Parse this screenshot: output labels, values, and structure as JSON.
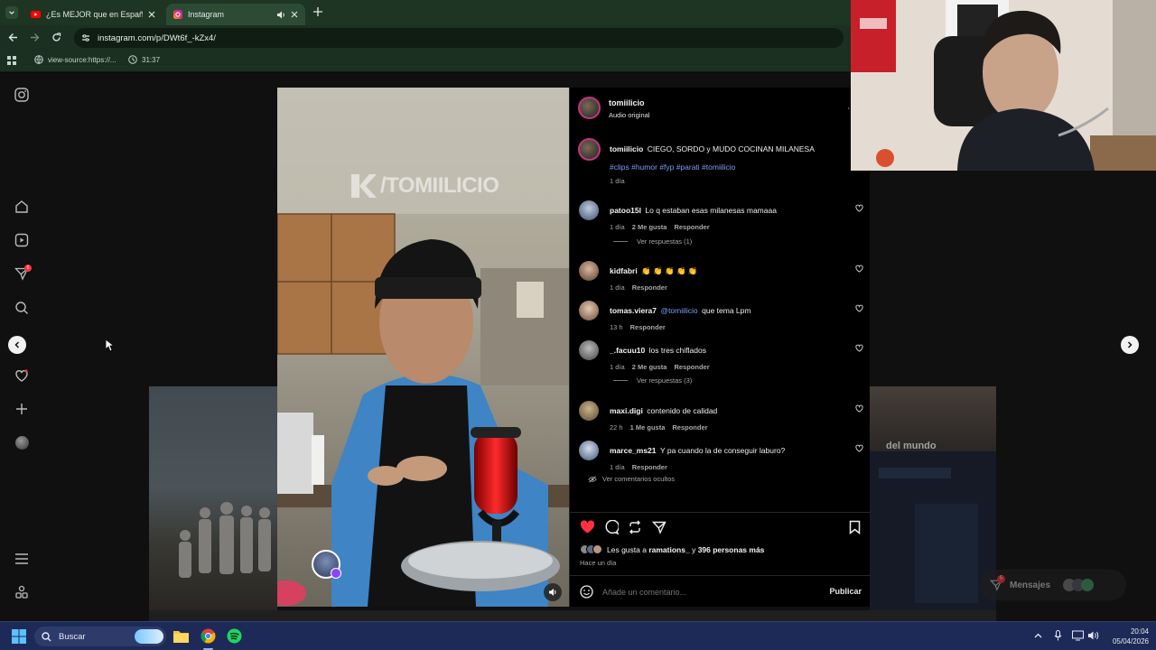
{
  "browser": {
    "tabs": [
      {
        "title": "¿Es MEJOR que en España? esu",
        "icon": "youtube-icon",
        "active": false
      },
      {
        "title": "Instagram",
        "icon": "instagram-icon",
        "active": true
      }
    ],
    "url": "instagram.com/p/DWt6f_-kZx4/",
    "bookmarks": [
      {
        "label": "view-source:https://...",
        "icon": "globe-icon"
      },
      {
        "label": "31:37",
        "icon": "clock-icon"
      }
    ]
  },
  "rail": {
    "notification_badge": "6"
  },
  "post": {
    "watermark": "/TOMIILICIO",
    "author": "tomiilicio",
    "audio": "Audio original",
    "caption_user": "tomiilicio",
    "caption": "CIEGO, SORDO y MUDO COCINAN MILANESA",
    "hashtags": "#clips #humor #fyp #parati #tomiilicio",
    "caption_time": "1 día",
    "comments": [
      {
        "user": "patoo15l",
        "text": "Lo q estaban esas milanesas mamaaa",
        "time": "1 día",
        "likes": "2 Me gusta",
        "reply": "Responder",
        "view_replies": "Ver respuestas (1)"
      },
      {
        "user": "kidfabri",
        "text": "👏 👏 👏 👏 👏",
        "time": "1 día",
        "likes": "",
        "reply": "Responder",
        "view_replies": ""
      },
      {
        "user": "tomas.viera7",
        "mention": "@tomiilicio",
        "text": "que tema Lpm",
        "time": "13 h",
        "likes": "",
        "reply": "Responder",
        "view_replies": ""
      },
      {
        "user": "_.facuu10",
        "text": "los tres chiflados",
        "time": "1 día",
        "likes": "2 Me gusta",
        "reply": "Responder",
        "view_replies": "Ver respuestas (3)"
      },
      {
        "user": "maxi.digi",
        "text": "contenido de calidad",
        "time": "22 h",
        "likes": "1 Me gusta",
        "reply": "Responder",
        "view_replies": ""
      },
      {
        "user": "marce_ms21",
        "text": "Y pa cuando la de conseguir laburo?",
        "time": "1 día",
        "likes": "",
        "reply": "Responder",
        "view_replies": ""
      }
    ],
    "hidden_comments": "Ver comentarios ocultos",
    "likes_prefix": "Les gusta a",
    "likes_user": "ramations_",
    "likes_suffix": "y",
    "likes_count": "396 personas más",
    "posted": "Hace un día",
    "comment_placeholder": "Añade un comentario...",
    "publish": "Publicar"
  },
  "side_thumb": {
    "caption": "del mundo"
  },
  "messages": {
    "label": "Mensajes",
    "badge": "5"
  },
  "taskbar": {
    "search": "Buscar",
    "time": "20:04",
    "date": "05/04/2026"
  },
  "colors": {
    "instagram_bg": "#101010",
    "like_red": "#ff3040",
    "link_blue": "#7f9cf5",
    "browser_green": "#1e3524",
    "taskbar_blue": "#1d2a57"
  }
}
